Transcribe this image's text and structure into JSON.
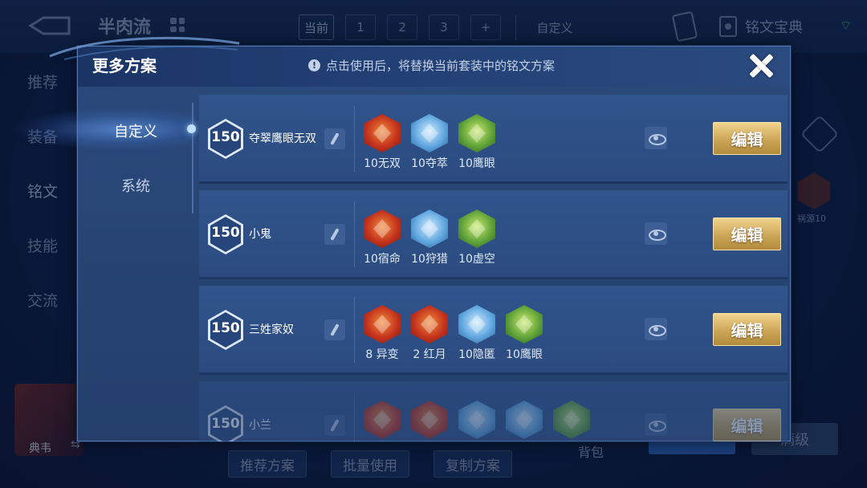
{
  "background": {
    "title": "半肉流",
    "plan_tabs": [
      "当前",
      "1",
      "2",
      "3",
      "+"
    ],
    "custom_tab": "自定义",
    "guide_label": "铭文宝典",
    "side_nav": [
      "推荐",
      "装备",
      "铭文",
      "技能",
      "交流"
    ],
    "hero_name": "典韦",
    "bottom_buttons": [
      "推荐方案",
      "批量使用",
      "复制方案"
    ],
    "bag_label": "背包",
    "full_level_label": "满级",
    "right_rune_label": "祸源10"
  },
  "modal": {
    "title": "更多方案",
    "notice": "点击使用后，将替换当前套装中的铭文方案",
    "tabs": [
      {
        "label": "自定义",
        "active": true
      },
      {
        "label": "系统",
        "active": false
      }
    ],
    "edit_label": "编辑",
    "plans": [
      {
        "level": "150",
        "name": "夺翠鹰眼无双",
        "runes": [
          {
            "label": "10无双",
            "color": "red"
          },
          {
            "label": "10夺萃",
            "color": "blue"
          },
          {
            "label": "10鹰眼",
            "color": "green"
          }
        ]
      },
      {
        "level": "150",
        "name": "小鬼",
        "runes": [
          {
            "label": "10宿命",
            "color": "red"
          },
          {
            "label": "10狩猎",
            "color": "blue"
          },
          {
            "label": "10虚空",
            "color": "green"
          }
        ]
      },
      {
        "level": "150",
        "name": "三姓家奴",
        "runes": [
          {
            "label": "8 异变",
            "color": "red"
          },
          {
            "label": "2 红月",
            "color": "red"
          },
          {
            "label": "10隐匿",
            "color": "blue"
          },
          {
            "label": "10鹰眼",
            "color": "green"
          }
        ]
      },
      {
        "level": "150",
        "name": "小兰",
        "runes": [
          {
            "label": "",
            "color": "red"
          },
          {
            "label": "",
            "color": "red"
          },
          {
            "label": "",
            "color": "blue"
          },
          {
            "label": "",
            "color": "blue"
          },
          {
            "label": "",
            "color": "green"
          }
        ]
      }
    ]
  },
  "colors": {
    "accent_gold": "#c9a253",
    "panel_blue": "#2b4b80",
    "active_tab_glow": "#6eaaff"
  }
}
